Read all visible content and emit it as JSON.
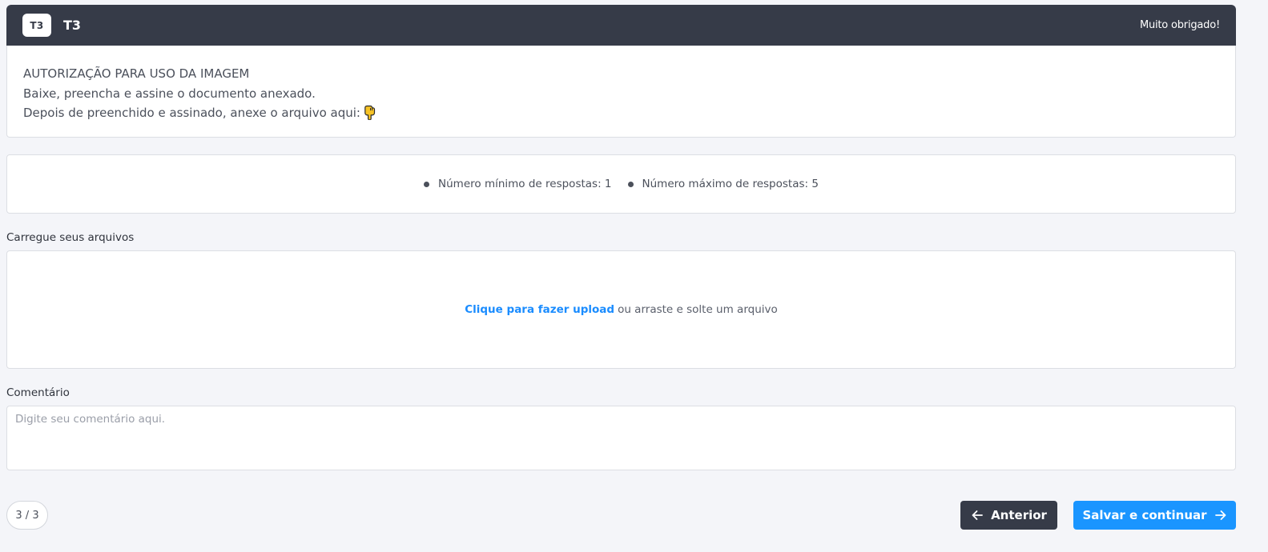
{
  "header": {
    "badge": "T3",
    "title": "T3",
    "thanks": "Muito obrigado!"
  },
  "description": {
    "line1": "AUTORIZAÇÃO PARA USO DA IMAGEM",
    "line2": "Baixe, preencha e assine o documento anexado.",
    "line3": "Depois de preenchido e assinado, anexe o arquivo aqui:",
    "pointer_icon": "pointing-down-hand-emoji"
  },
  "rules": {
    "min": "Número mínimo de respostas: 1",
    "max": "Número máximo de respostas: 5"
  },
  "upload": {
    "label": "Carregue seus arquivos",
    "link_text": "Clique para fazer upload",
    "rest_text": "ou arraste e solte um arquivo"
  },
  "comment": {
    "label": "Comentário",
    "placeholder": "Digite seu comentário aqui.",
    "value": ""
  },
  "footer": {
    "page_indicator": "3 / 3",
    "prev_label": "Anterior",
    "next_label": "Salvar e continuar"
  },
  "colors": {
    "header_bg": "#363b48",
    "primary": "#1a95ff",
    "link": "#1a8cff",
    "page_bg": "#f4f5f9"
  }
}
